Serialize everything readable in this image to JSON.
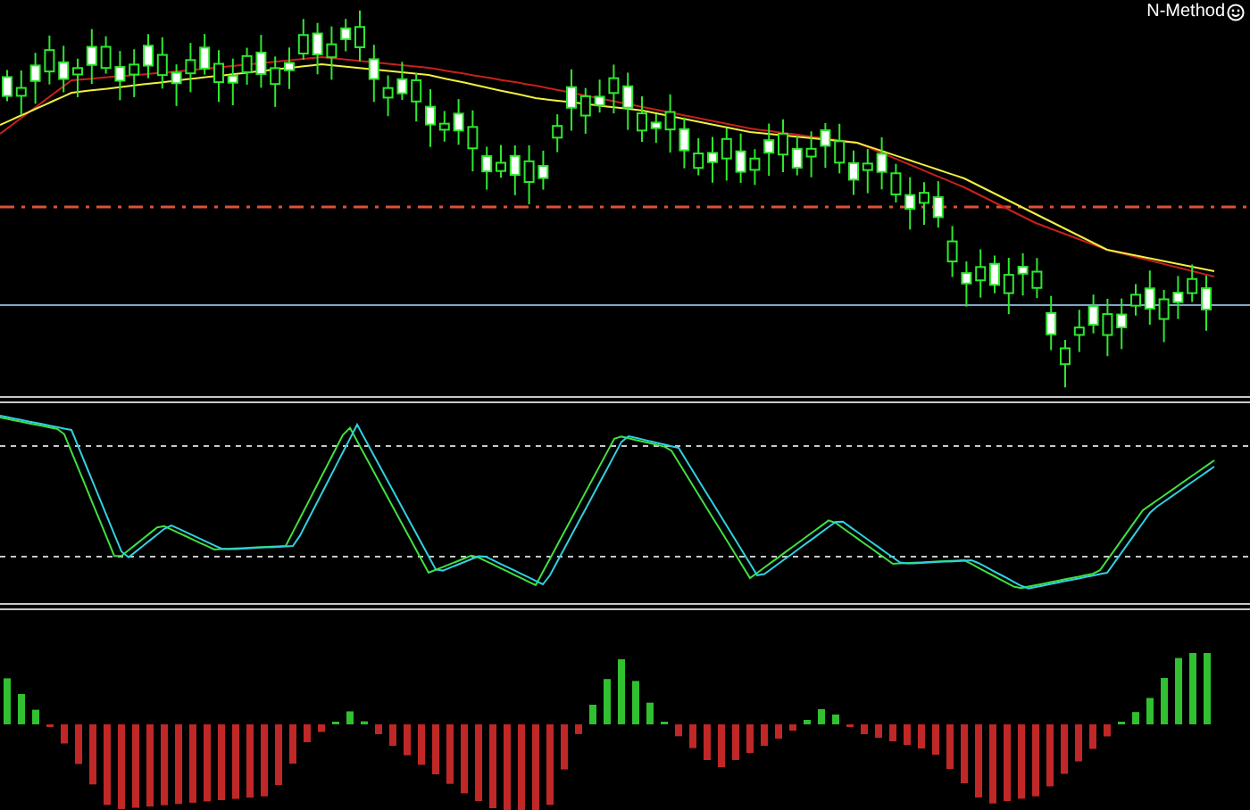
{
  "price_chart": {
    "indicator_label": "N-Method"
  }
}
